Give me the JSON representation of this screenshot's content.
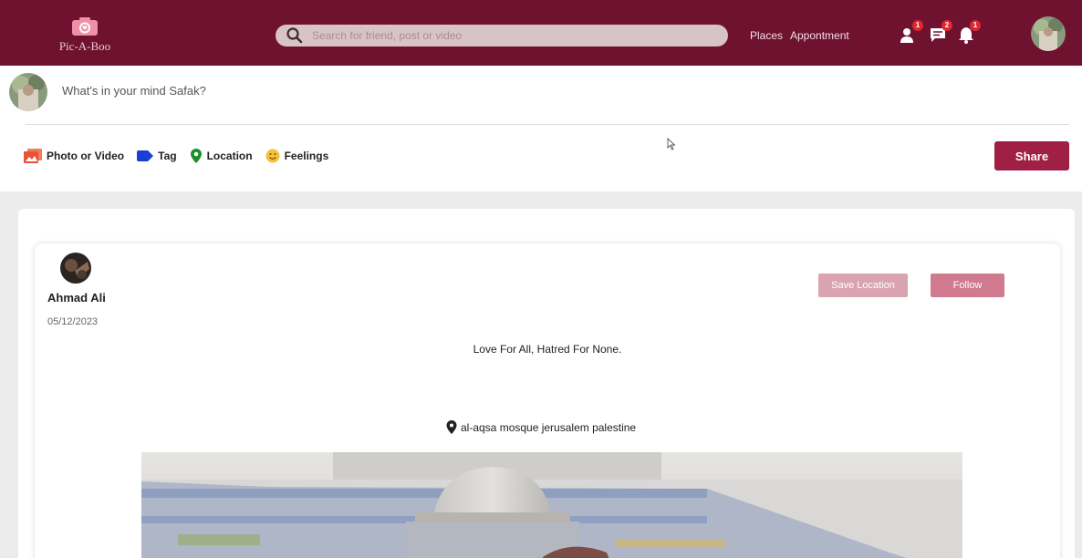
{
  "app": {
    "name": "Pic-A-Boo"
  },
  "header": {
    "search_placeholder": "Search for friend, post or video",
    "nav": {
      "places": "Places",
      "appointment": "Appontment"
    },
    "badges": {
      "friends": "1",
      "messages": "2",
      "notifications": "1"
    },
    "colors": {
      "bar": "#6e1230",
      "badge": "#e0262e"
    }
  },
  "composer": {
    "placeholder": "What's in your mind Safak?",
    "actions": {
      "photo": "Photo or Video",
      "tag": "Tag",
      "location": "Location",
      "feelings": "Feelings"
    },
    "share_label": "Share"
  },
  "post": {
    "author": "Ahmad Ali",
    "date": "05/12/2023",
    "save_location_label": "Save Location",
    "follow_label": "Follow",
    "caption": "Love For All, Hatred For None.",
    "location": "al-aqsa mosque jerusalem palestine"
  }
}
